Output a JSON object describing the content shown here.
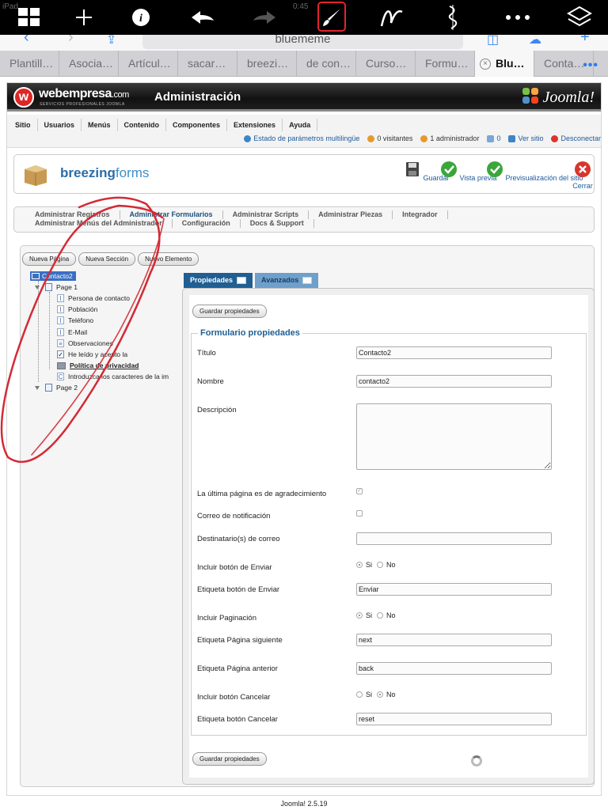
{
  "status": {
    "carrier": "iPad",
    "time": "0:45"
  },
  "annotation_toolbar": {
    "tools": [
      {
        "name": "grid-icon"
      },
      {
        "name": "plus-icon"
      },
      {
        "name": "info-icon"
      },
      {
        "name": "undo-icon"
      },
      {
        "name": "redo-icon"
      },
      {
        "name": "brush-icon",
        "active": true
      },
      {
        "name": "pen-icon"
      },
      {
        "name": "eraser-icon"
      },
      {
        "name": "more-icon"
      },
      {
        "name": "layers-icon"
      }
    ],
    "active_color": "#e4232e"
  },
  "browser": {
    "url": "bluememe",
    "tabs": [
      "Plantill…",
      "Asocia…",
      "Artícul…",
      "sacar…",
      "breezi…",
      "de con…",
      "Curso…",
      "Formu…",
      "Blu…",
      "Conta…"
    ],
    "active_tab_index": 8,
    "more": "•••"
  },
  "header": {
    "logo_mark": "w",
    "logo_name": "webempresa",
    "logo_suffix": ".com",
    "logo_tagline": "SERVICIOS PROFESIONALES JOOMLA",
    "title": "Administración",
    "joomla": "Joomla!"
  },
  "menu": [
    "Sitio",
    "Usuarios",
    "Menús",
    "Contenido",
    "Componentes",
    "Extensiones",
    "Ayuda"
  ],
  "status_bar": {
    "multilang": "Estado de parámetros multilingüe",
    "visitors": "0 visitantes",
    "admins": "1 administrador",
    "messages": "0",
    "view_site": "Ver sitio",
    "logout": "Desconectar"
  },
  "toolbar": {
    "brand_bold": "breezing",
    "brand_light": "forms",
    "buttons": {
      "save": "Guardar",
      "preview": "Vista previa",
      "site_preview": "Previsualización del sitio",
      "close": "Cerrar"
    }
  },
  "subnav": {
    "row1": [
      "Administrar Registros",
      "Administrar Formularios",
      "Administrar Scripts",
      "Administrar Piezas",
      "Integrador"
    ],
    "row2": [
      "Administrar Menús del Administrador",
      "Configuración",
      "Docs & Support"
    ],
    "active": "Administrar Formularios"
  },
  "element_buttons": [
    "Nueva Página",
    "Nueva Sección",
    "Nuevo Elemento"
  ],
  "tree": {
    "root": "Contacto2",
    "page1": "Page 1",
    "items": [
      {
        "label": "Persona de contacto",
        "type": "text"
      },
      {
        "label": "Población",
        "type": "text"
      },
      {
        "label": "Teléfono",
        "type": "text"
      },
      {
        "label": "E-Mail",
        "type": "text"
      },
      {
        "label": "Observaciones",
        "type": "textarea"
      },
      {
        "label": "He leído y acepto la",
        "type": "checkbox"
      },
      {
        "label": "Política de privacidad",
        "type": "section"
      },
      {
        "label": "Introduzca los caracteres de la im",
        "type": "captcha"
      }
    ],
    "page2": "Page 2"
  },
  "props_tabs": {
    "properties": "Propiedades",
    "advanced": "Avanzados"
  },
  "form": {
    "save_label": "Guardar propiedades",
    "legend": "Formulario propiedades",
    "title_label": "Título",
    "title_value": "Contacto2",
    "name_label": "Nombre",
    "name_value": "contacto2",
    "description_label": "Descripción",
    "last_page_thanks_label": "La última página es de agradecimiento",
    "last_page_thanks_checked": true,
    "notify_label": "Correo de notificación",
    "notify_checked": false,
    "recipients_label": "Destinatario(s) de correo",
    "recipients_value": "",
    "include_submit_label": "Incluir botón de Enviar",
    "include_submit": "Si",
    "submit_text_label": "Etiqueta botón de Enviar",
    "submit_text_value": "Enviar",
    "include_paging_label": "Incluir Paginación",
    "include_paging": "Si",
    "next_label": "Etiqueta Página siguiente",
    "next_value": "next",
    "prev_label": "Etiqueta Página anterior",
    "prev_value": "back",
    "include_cancel_label": "Incluir botón Cancelar",
    "include_cancel": "No",
    "cancel_text_label": "Etiqueta botón Cancelar",
    "cancel_text_value": "reset",
    "yes": "Si",
    "no": "No"
  },
  "footer": "Joomla! 2.5.19"
}
